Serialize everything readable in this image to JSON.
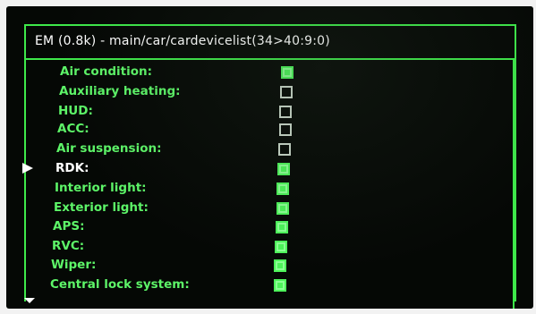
{
  "window": {
    "title": "EM (0.8k) - main/car/cardevicelist(34>40:9:0)"
  },
  "list": {
    "items": [
      {
        "label": "Air condition:",
        "checked": true,
        "selected": false
      },
      {
        "label": "Auxiliary heating:",
        "checked": false,
        "selected": false
      },
      {
        "label": "HUD:",
        "checked": false,
        "selected": false
      },
      {
        "label": "ACC:",
        "checked": false,
        "selected": false
      },
      {
        "label": "Air suspension:",
        "checked": false,
        "selected": false
      },
      {
        "label": "RDK:",
        "checked": true,
        "selected": true
      },
      {
        "label": "Interior light:",
        "checked": true,
        "selected": false
      },
      {
        "label": "Exterior light:",
        "checked": true,
        "selected": false
      },
      {
        "label": "APS:",
        "checked": true,
        "selected": false
      },
      {
        "label": "RVC:",
        "checked": true,
        "selected": false
      },
      {
        "label": "Wiper:",
        "checked": true,
        "selected": false
      },
      {
        "label": "Central lock system:",
        "checked": true,
        "selected": false
      }
    ]
  },
  "colors": {
    "accent_green": "#3ee84a",
    "label_green": "#5df568",
    "selected_text": "#ffffff",
    "background": "#050805"
  }
}
